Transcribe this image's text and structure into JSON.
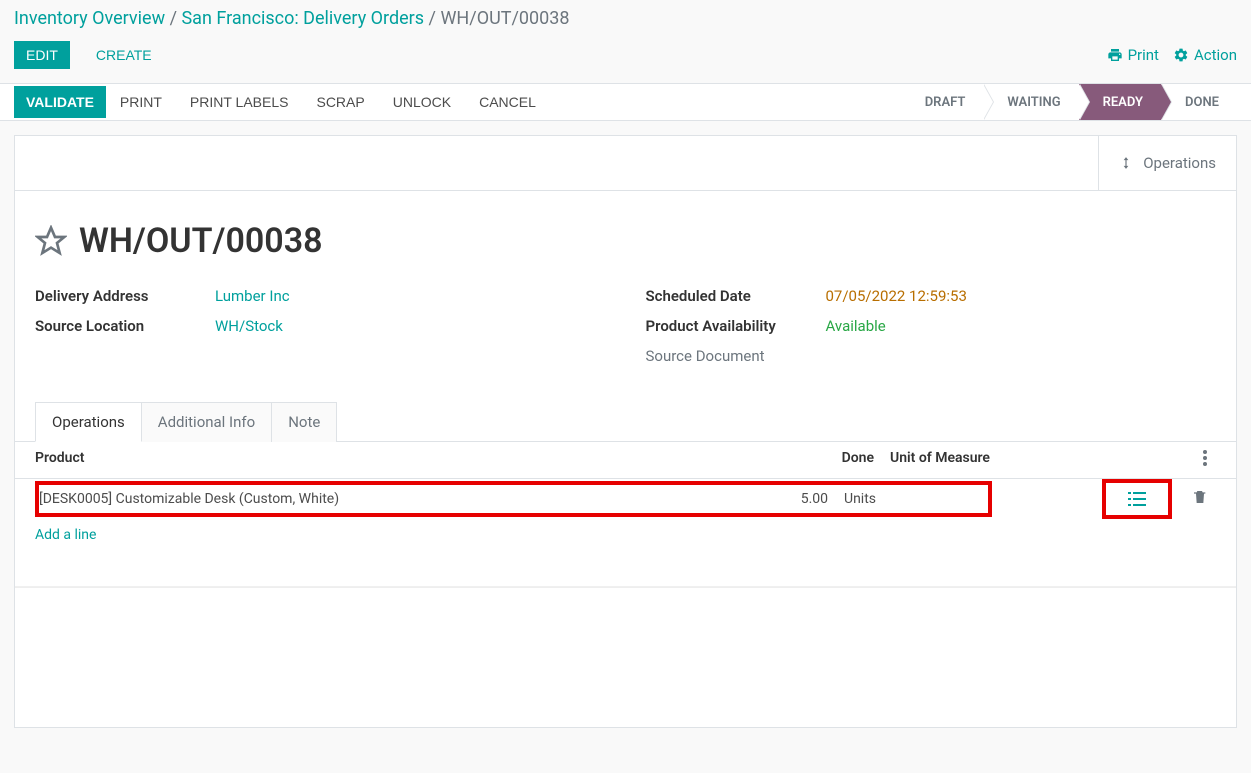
{
  "breadcrumb": {
    "inventory_overview": "Inventory Overview",
    "delivery_orders": "San Francisco: Delivery Orders",
    "current": "WH/OUT/00038"
  },
  "top_actions": {
    "edit": "EDIT",
    "create": "CREATE",
    "print": "Print",
    "action": "Action"
  },
  "toolbar": {
    "validate": "VALIDATE",
    "print": "PRINT",
    "print_labels": "PRINT LABELS",
    "scrap": "SCRAP",
    "unlock": "UNLOCK",
    "cancel": "CANCEL"
  },
  "status": {
    "draft": "DRAFT",
    "waiting": "WAITING",
    "ready": "READY",
    "done": "DONE"
  },
  "ops_btn": "Operations",
  "record": {
    "title": "WH/OUT/00038"
  },
  "fields": {
    "delivery_address_label": "Delivery Address",
    "delivery_address_value": "Lumber Inc",
    "source_location_label": "Source Location",
    "source_location_value": "WH/Stock",
    "scheduled_date_label": "Scheduled Date",
    "scheduled_date_value": "07/05/2022 12:59:53",
    "product_availability_label": "Product Availability",
    "product_availability_value": "Available",
    "source_document_label": "Source Document"
  },
  "tabs": {
    "operations": "Operations",
    "additional_info": "Additional Info",
    "note": "Note"
  },
  "table": {
    "headers": {
      "product": "Product",
      "done": "Done",
      "uom": "Unit of Measure"
    },
    "rows": [
      {
        "product": "[DESK0005] Customizable Desk (Custom, White)",
        "done": "5.00",
        "uom": "Units"
      }
    ],
    "add_line": "Add a line"
  }
}
